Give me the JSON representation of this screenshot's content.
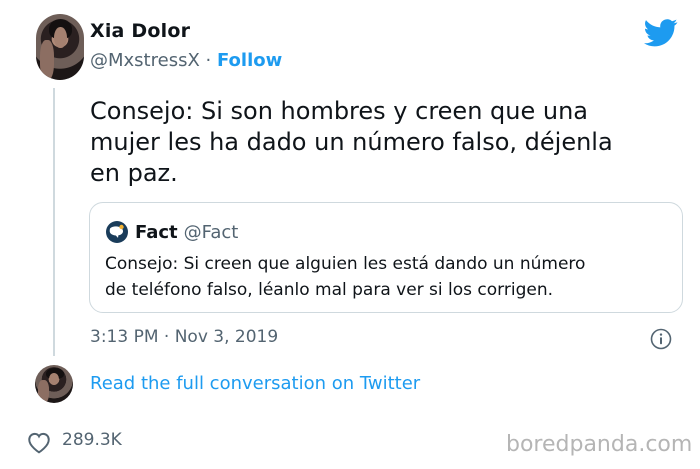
{
  "author": {
    "display_name": "Xia Dolor",
    "handle": "@MxstressX",
    "separator": " · ",
    "follow_label": "Follow"
  },
  "tweet": {
    "text_lines": [
      "Consejo: Si son hombres y creen que una",
      "mujer les ha dado un número falso, déjenla",
      "en paz."
    ],
    "timestamp": "3:13 PM · Nov 3, 2019"
  },
  "quoted_tweet": {
    "name": "Fact",
    "handle": "@Fact",
    "text_lines": [
      "Consejo: Si creen que alguien les está dando un número",
      "de teléfono falso, léanlo mal para ver si los corrigen."
    ]
  },
  "footer": {
    "read_link": "Read the full conversation on Twitter",
    "likes": "289.3K"
  },
  "watermark": "boredpanda.com",
  "icons": {
    "brand": "twitter-bird-icon",
    "info": "info-icon",
    "like": "heart-icon",
    "fact_avatar": "fact-logo-icon"
  },
  "colors": {
    "accent": "#1d9bf0",
    "text": "#0f1419",
    "muted": "#536471",
    "border": "#cfd9de"
  }
}
